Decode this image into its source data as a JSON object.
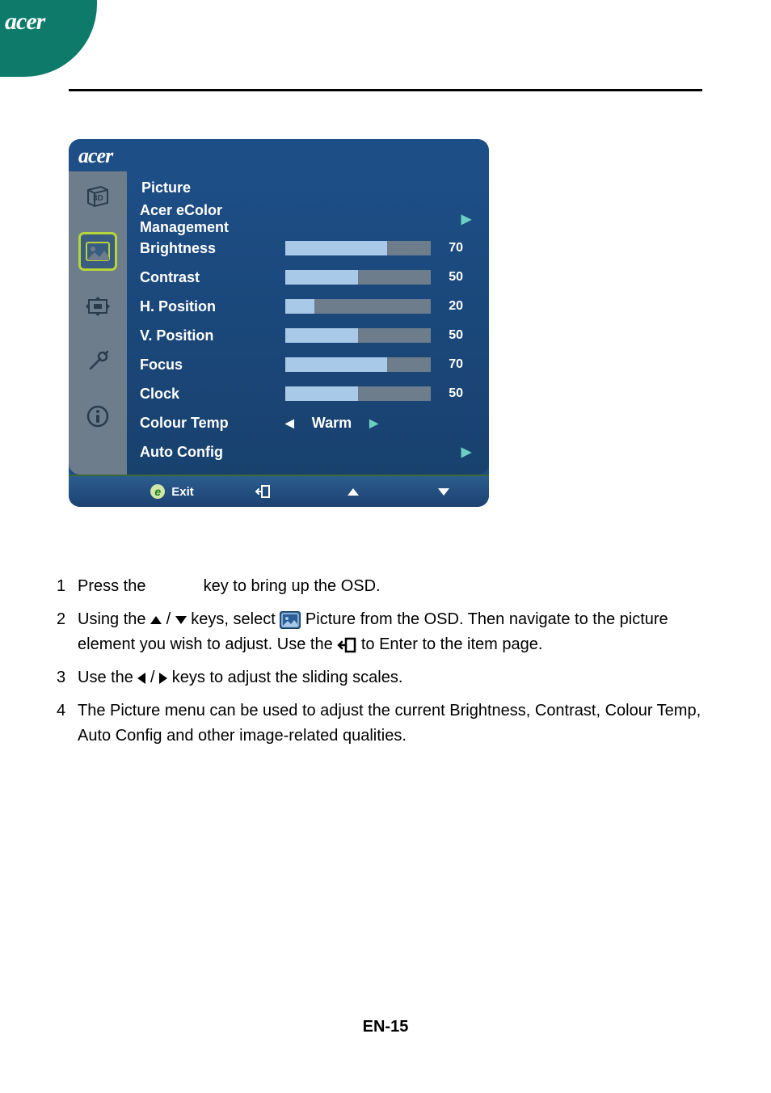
{
  "brand": "acer",
  "osd": {
    "brand": "acer",
    "section_title": "Picture",
    "items": {
      "ecolor": {
        "label": "Acer eColor Management"
      },
      "brightness": {
        "label": "Brightness",
        "value": 70
      },
      "contrast": {
        "label": "Contrast",
        "value": 50
      },
      "hpos": {
        "label": "H. Position",
        "value": 20
      },
      "vpos": {
        "label": "V. Position",
        "value": 50
      },
      "focus": {
        "label": "Focus",
        "value": 70
      },
      "clock": {
        "label": "Clock",
        "value": 50
      },
      "colourtemp": {
        "label": "Colour Temp",
        "selected": "Warm"
      },
      "autoconfig": {
        "label": "Auto Config"
      }
    },
    "footer": {
      "exit": "Exit"
    }
  },
  "instructions": {
    "i1a": "Press the ",
    "i1b": " key to bring up the OSD.",
    "i2a": "Using the ",
    "i2b": " keys, select ",
    "i2c": " Picture from the OSD. Then navigate to the picture element you wish to adjust. Use the ",
    "i2d": " to Enter to the item page.",
    "i3a": "Use the ",
    "i3b": " keys to adjust the sliding scales.",
    "i4": "The Picture menu can be used to adjust the current Brightness, Contrast, Colour Temp, Auto Config and other image-related qualities."
  },
  "page_number": "EN-15"
}
